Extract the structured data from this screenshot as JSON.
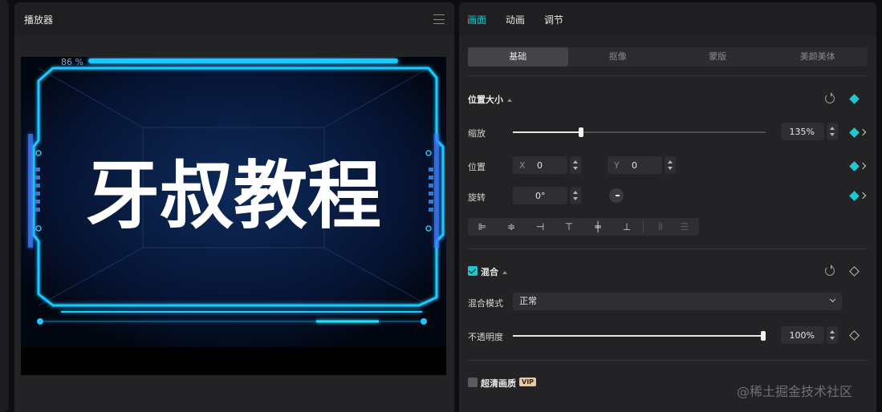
{
  "player": {
    "title": "播放器",
    "canvas": {
      "text": "牙叔教程",
      "percent_label": "86 %",
      "accent": "#1ec8ff"
    }
  },
  "props": {
    "tabs": [
      {
        "label": "画面",
        "active": true
      },
      {
        "label": "动画",
        "active": false
      },
      {
        "label": "调节",
        "active": false
      }
    ],
    "segments": [
      {
        "label": "基础",
        "active": true
      },
      {
        "label": "抠像",
        "active": false
      },
      {
        "label": "蒙版",
        "active": false
      },
      {
        "label": "美颜美体",
        "active": false
      }
    ],
    "position_size": {
      "section_label": "位置大小",
      "scale": {
        "label": "缩放",
        "value": "135%",
        "level": 0.27
      },
      "position": {
        "label": "位置",
        "x_label": "X",
        "x_value": "0",
        "y_label": "Y",
        "y_value": "0"
      },
      "rotation": {
        "label": "旋转",
        "value": "0°"
      }
    },
    "blend": {
      "section_label": "混合",
      "checked": true,
      "mode_label": "混合模式",
      "mode_value": "正常",
      "opacity_label": "不透明度",
      "opacity_value": "100%",
      "opacity_level": 1.0
    },
    "hd": {
      "label": "超清画质",
      "checked": false,
      "badge": "VIP"
    },
    "colors": {
      "accent": "#1fc7d1",
      "panel": "#232326",
      "control": "#2f2f33"
    }
  },
  "watermark": "@稀土掘金技术社区"
}
